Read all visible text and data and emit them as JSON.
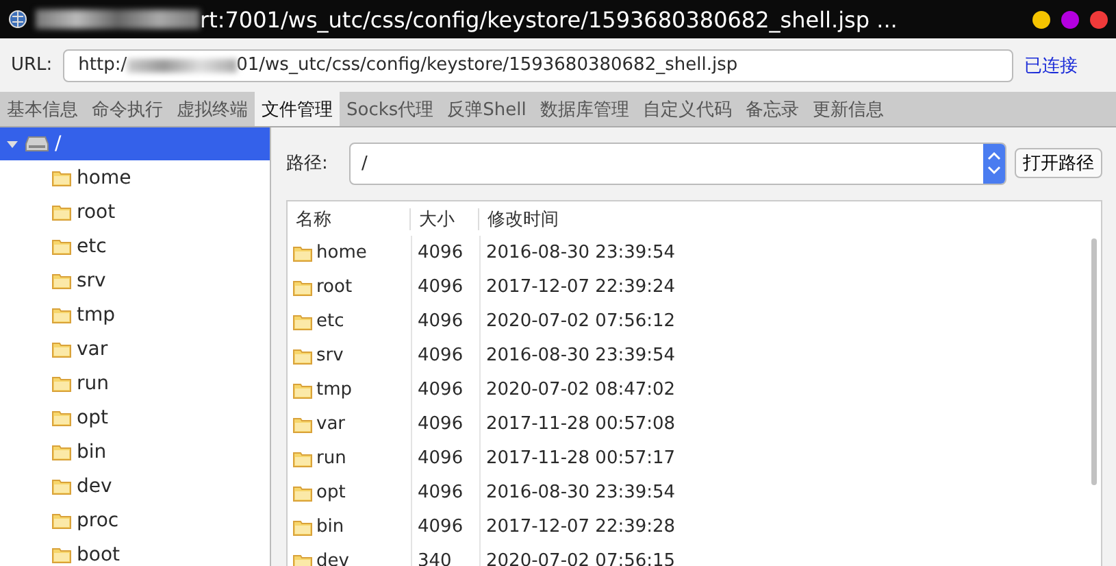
{
  "window": {
    "title": "rt:7001/ws_utc/css/config/keystore/1593680380682_shell.jsp ..."
  },
  "url_bar": {
    "label": "URL:",
    "value_start": "http:/",
    "value_end": "01/ws_utc/css/config/keystore/1593680380682_shell.jsp",
    "status": "已连接"
  },
  "tabs": [
    {
      "label": "基本信息",
      "selected": false
    },
    {
      "label": "命令执行",
      "selected": false
    },
    {
      "label": "虚拟终端",
      "selected": false
    },
    {
      "label": "文件管理",
      "selected": true
    },
    {
      "label": "Socks代理",
      "selected": false
    },
    {
      "label": "反弹Shell",
      "selected": false
    },
    {
      "label": "数据库管理",
      "selected": false
    },
    {
      "label": "自定义代码",
      "selected": false
    },
    {
      "label": "备忘录",
      "selected": false
    },
    {
      "label": "更新信息",
      "selected": false
    }
  ],
  "tree": [
    {
      "label": "/",
      "selected": true,
      "expanded": true,
      "children": [
        {
          "label": "home",
          "selected": false
        },
        {
          "label": "root",
          "selected": false
        },
        {
          "label": "etc",
          "selected": false
        },
        {
          "label": "srv",
          "selected": false
        },
        {
          "label": "tmp",
          "selected": false
        },
        {
          "label": "var",
          "selected": false
        },
        {
          "label": "run",
          "selected": false
        },
        {
          "label": "opt",
          "selected": false
        },
        {
          "label": "bin",
          "selected": false
        },
        {
          "label": "dev",
          "selected": false
        },
        {
          "label": "proc",
          "selected": false
        },
        {
          "label": "boot",
          "selected": false
        }
      ]
    }
  ],
  "path": {
    "label": "路径:",
    "value": "/",
    "button": "打开路径"
  },
  "table": {
    "columns": [
      "名称",
      "大小",
      "修改时间"
    ],
    "rows": [
      [
        "home",
        "4096",
        "2016-08-30 23:39:54"
      ],
      [
        "root",
        "4096",
        "2017-12-07 22:39:24"
      ],
      [
        "etc",
        "4096",
        "2020-07-02 07:56:12"
      ],
      [
        "srv",
        "4096",
        "2016-08-30 23:39:54"
      ],
      [
        "tmp",
        "4096",
        "2020-07-02 08:47:02"
      ],
      [
        "var",
        "4096",
        "2017-11-28 00:57:08"
      ],
      [
        "run",
        "4096",
        "2017-11-28 00:57:17"
      ],
      [
        "opt",
        "4096",
        "2016-08-30 23:39:54"
      ],
      [
        "bin",
        "4096",
        "2017-12-07 22:39:28"
      ],
      [
        "dev",
        "340",
        "2020-07-02 07:56:15"
      ]
    ]
  }
}
